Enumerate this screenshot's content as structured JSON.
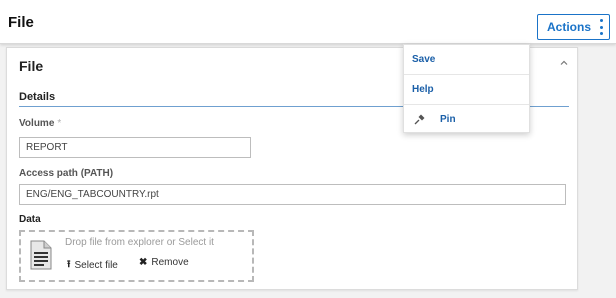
{
  "header": {
    "title": "File",
    "actions_label": "Actions"
  },
  "card": {
    "title": "File",
    "section_title": "Details",
    "volume": {
      "label": "Volume",
      "required_marker": "*",
      "value": "REPORT"
    },
    "access_path": {
      "label": "Access path (PATH)",
      "value": "ENG/ENG_TABCOUNTRY.rpt"
    },
    "data": {
      "label": "Data",
      "drop_hint": "Drop file from explorer or Select it",
      "select_label": "Select file",
      "remove_label": "Remove"
    }
  },
  "actions_menu": {
    "items": [
      {
        "label": "Save"
      },
      {
        "label": "Help"
      },
      {
        "label": "Pin",
        "icon": "pin-icon"
      }
    ]
  },
  "colors": {
    "accent": "#1a73c8",
    "menu_text": "#1a5fa8",
    "backdrop": "#f2f2f2"
  }
}
